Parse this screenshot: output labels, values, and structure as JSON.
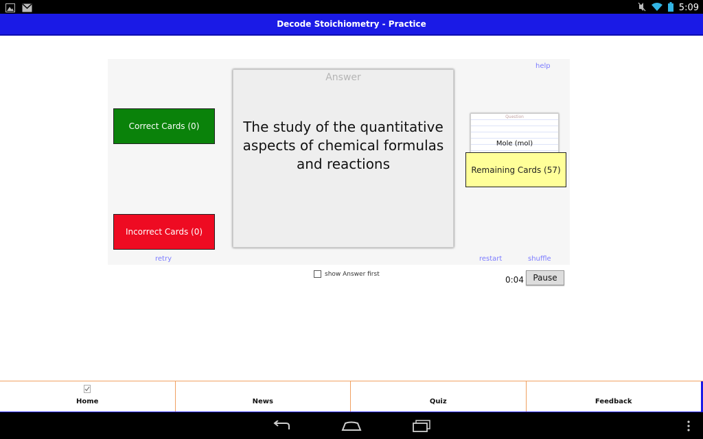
{
  "status_bar": {
    "time": "5:09",
    "left_icons": [
      "image-icon",
      "mail-icon"
    ],
    "right_icons": [
      "mute-icon",
      "wifi-icon",
      "battery-icon"
    ]
  },
  "app": {
    "title": "Decode Stoichiometry - Practice",
    "accent_color": "#1a1ae6"
  },
  "practice": {
    "help_link": "help",
    "retry_link": "retry",
    "restart_link": "restart",
    "shuffle_link": "shuffle",
    "correct_button": "Correct Cards (0)",
    "incorrect_button": "Incorrect Cards (0)",
    "remaining_button": "Remaining Cards (57)",
    "main_card": {
      "label": "Answer",
      "text": "The study of the quantitative aspects of chemical formulas and reactions"
    },
    "next_card": {
      "label": "Question",
      "text": "Mole (mol)"
    },
    "show_answer_first": {
      "label": "show Answer first",
      "checked": false
    },
    "timer": "0:04",
    "pause_button": "Pause",
    "colors": {
      "correct": "#0a820a",
      "incorrect": "#ee0b22",
      "remaining": "#ffff99"
    }
  },
  "tabs": [
    {
      "label": "Home",
      "icon": "check-document-icon"
    },
    {
      "label": "News"
    },
    {
      "label": "Quiz"
    },
    {
      "label": "Feedback"
    }
  ],
  "nav_bar": {
    "buttons": [
      "back-icon",
      "home-icon",
      "recent-apps-icon",
      "overflow-menu-icon"
    ]
  }
}
